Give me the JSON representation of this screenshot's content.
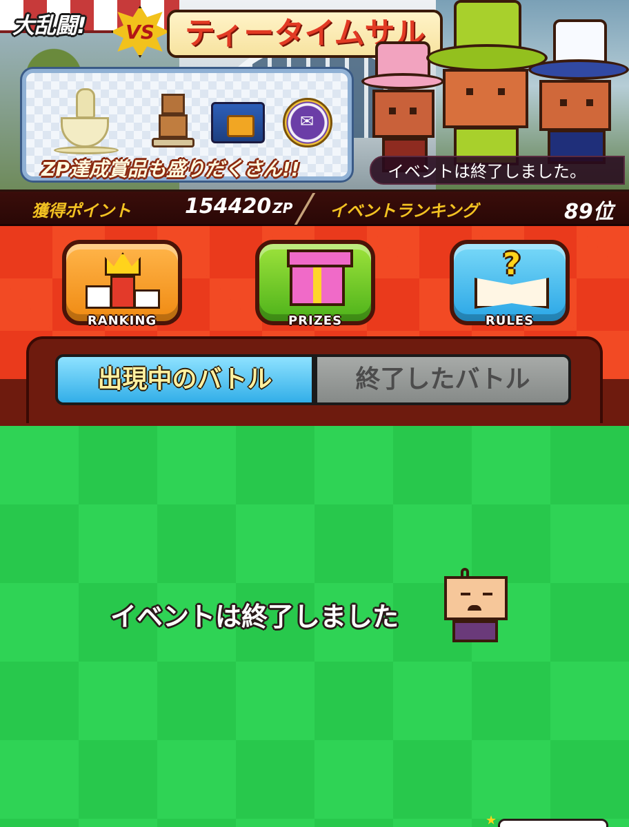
{
  "banner": {
    "title_prefix": "大乱闘!",
    "vs_label": "VS",
    "event_name": "ティータイムサル",
    "prize_caption": "ZP達成賞品も盛りだくさん!!",
    "status_ribbon": "イベントは終了しました。"
  },
  "stats": {
    "points_label": "獲得ポイント",
    "points_value": "154420",
    "points_unit": "ZP",
    "ranking_label": "イベントランキング",
    "ranking_value": "89位"
  },
  "menu": {
    "ranking_label": "RANKING",
    "prizes_label": "PRIZES",
    "rules_label": "RULES"
  },
  "tabs": {
    "active_label": "出現中のバトル",
    "inactive_label": "終了したバトル"
  },
  "battle_list": {
    "empty_message": "イベントは終了しました"
  },
  "colors": {
    "menu_bg": "#ea3a1c",
    "list_bg": "#2fd355",
    "active_tab": "#32aee8",
    "inactive_tab": "#868a88",
    "stat_label": "#f3c222"
  },
  "icons": [
    "crown-icon",
    "gift-icon",
    "rules-book-icon",
    "trophy-cup-icon",
    "robot-trophy-icon",
    "treasure-chest-icon",
    "medal-icon"
  ]
}
